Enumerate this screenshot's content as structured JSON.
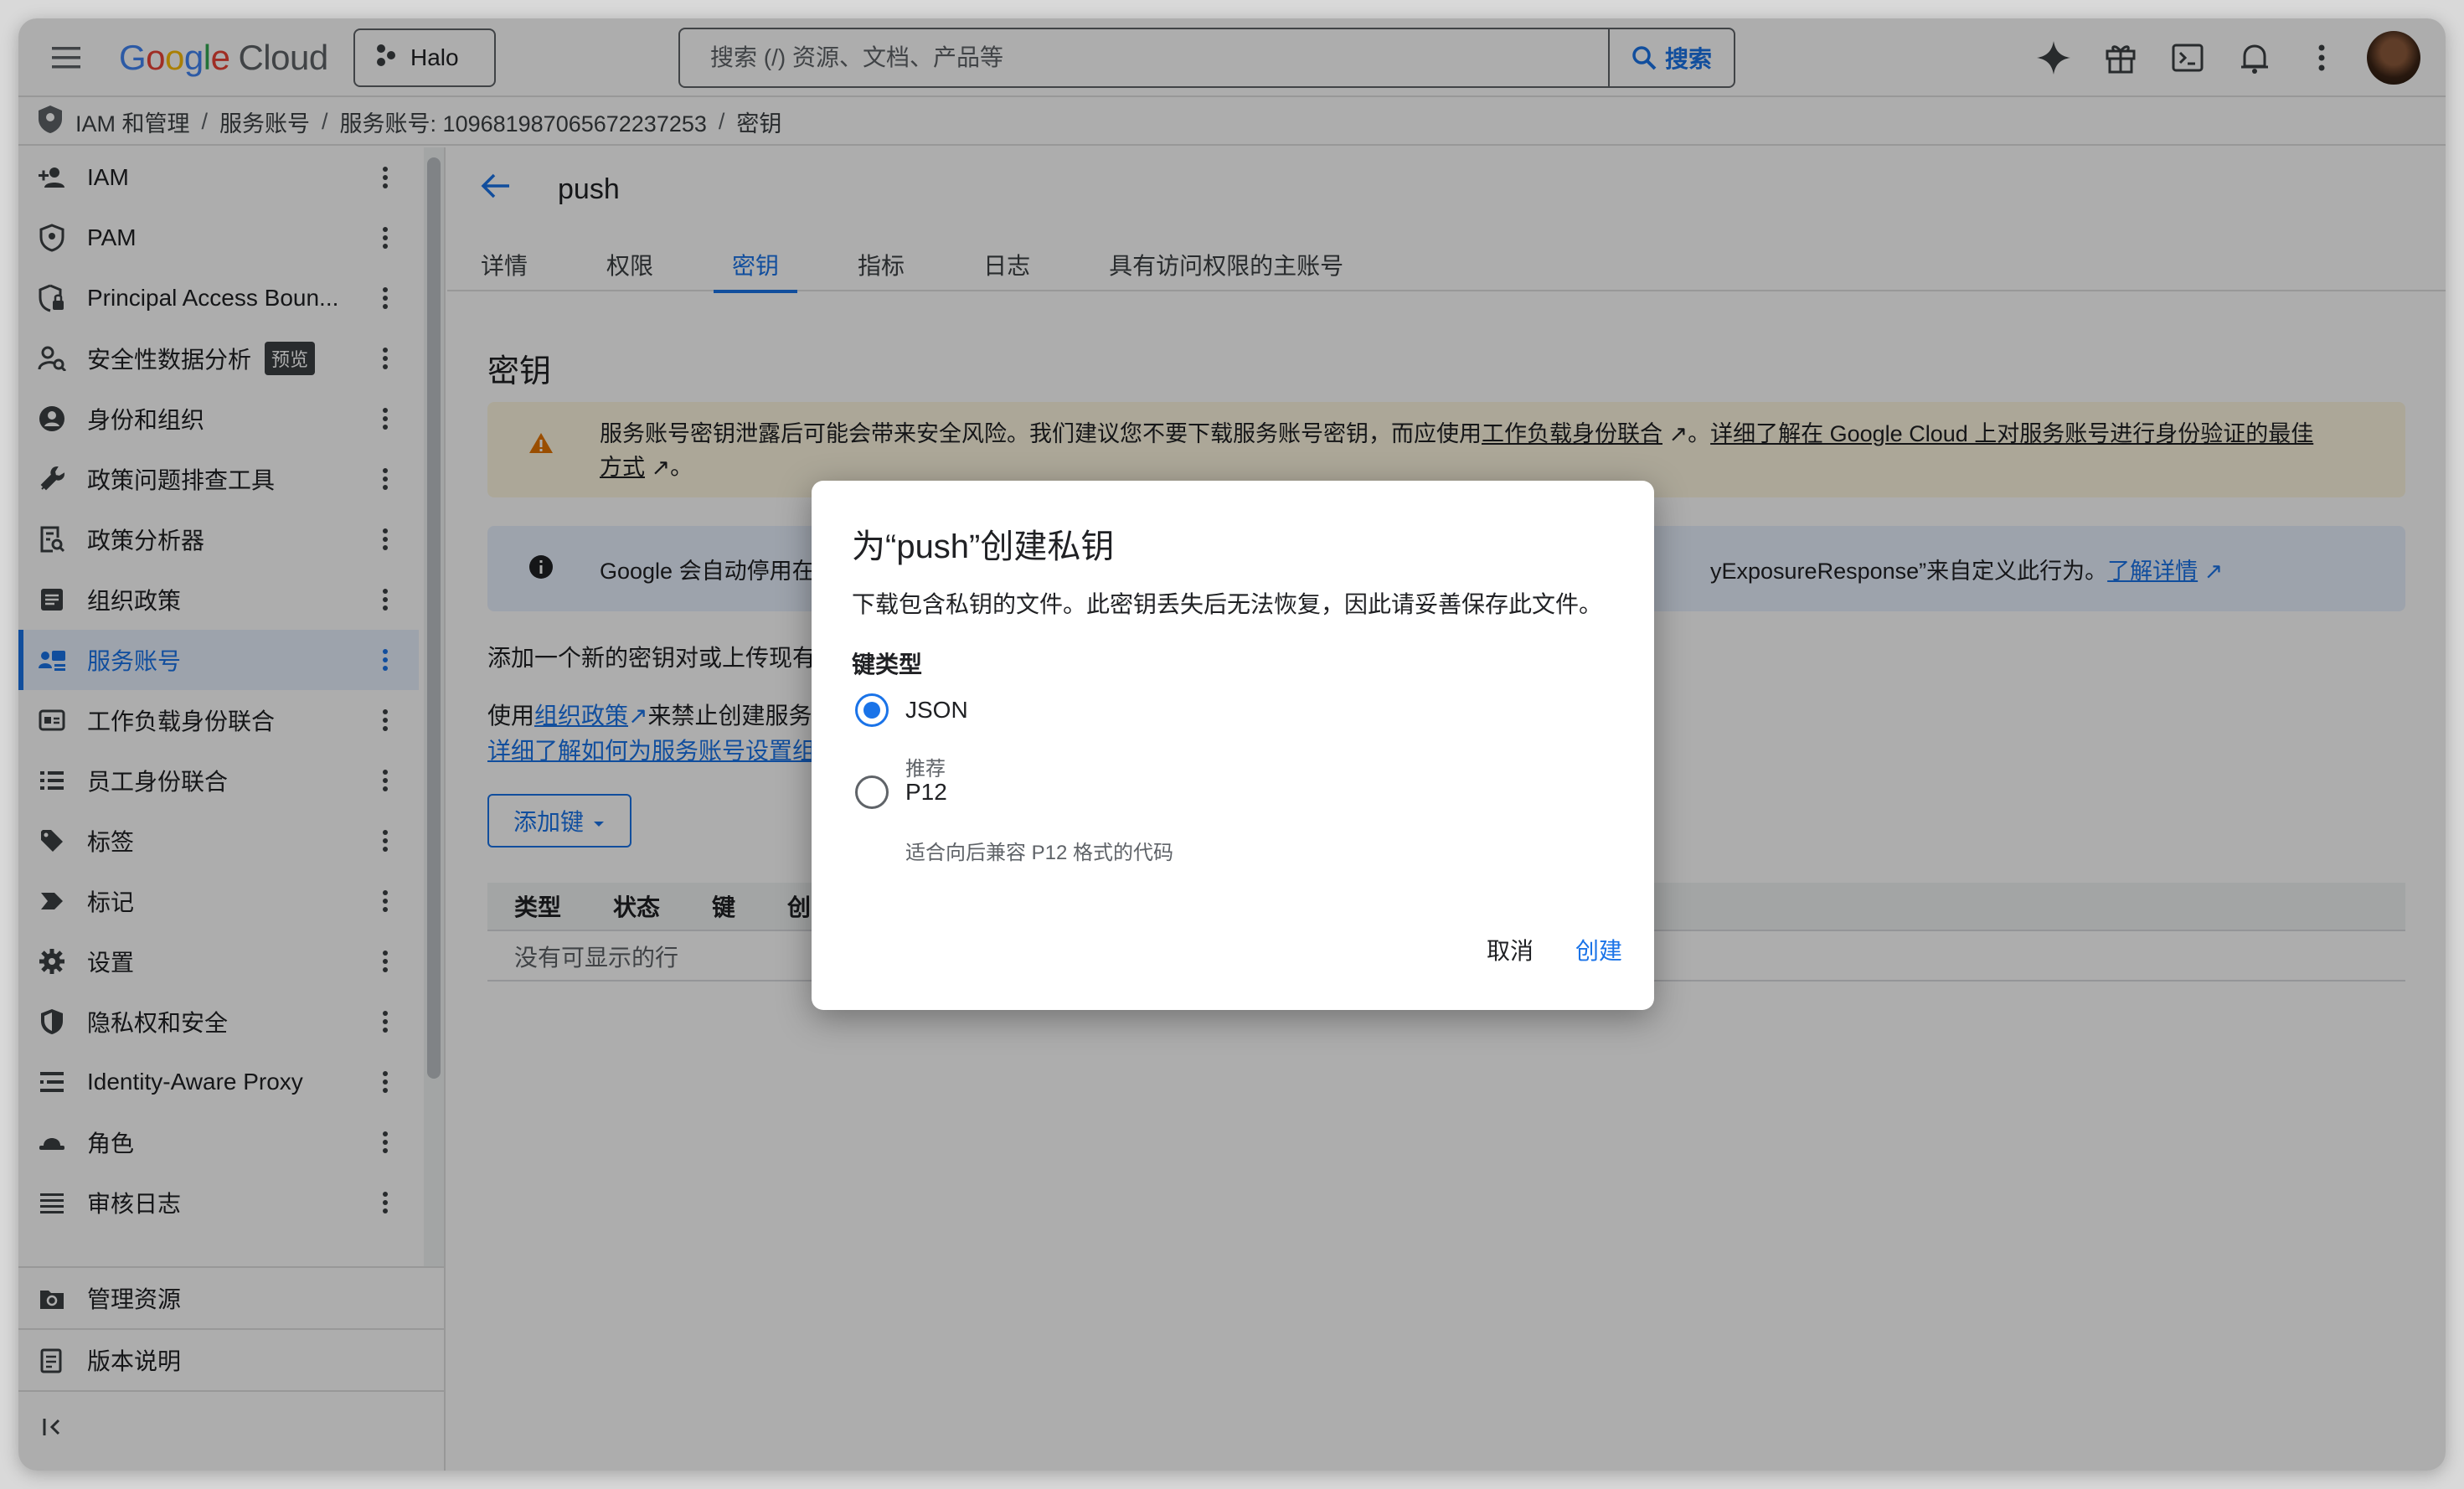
{
  "topbar": {
    "logo_parts": [
      "G",
      "o",
      "o",
      "g",
      "l",
      "e"
    ],
    "logo_cloud": "Cloud",
    "project_name": "Halo",
    "search_placeholder": "搜索 (/) 资源、文档、产品等",
    "search_button": "搜索"
  },
  "breadcrumb": {
    "items": [
      "IAM 和管理",
      "服务账号",
      "服务账号: 109681987065672237253",
      "密钥"
    ]
  },
  "sidebar": {
    "items": [
      {
        "label": "IAM",
        "icon": "person-add-icon"
      },
      {
        "label": "PAM",
        "icon": "shield-icon"
      },
      {
        "label": "Principal Access Boun...",
        "icon": "shield-lock-icon"
      },
      {
        "label": "安全性数据分析",
        "icon": "person-search-icon",
        "badge": "预览"
      },
      {
        "label": "身份和组织",
        "icon": "account-circle-icon"
      },
      {
        "label": "政策问题排查工具",
        "icon": "wrench-icon"
      },
      {
        "label": "政策分析器",
        "icon": "doc-search-icon"
      },
      {
        "label": "组织政策",
        "icon": "list-box-icon"
      },
      {
        "label": "服务账号",
        "icon": "service-account-icon"
      },
      {
        "label": "工作负载身份联合",
        "icon": "id-card-icon"
      },
      {
        "label": "员工身份联合",
        "icon": "list-icon"
      },
      {
        "label": "标签",
        "icon": "tag-icon"
      },
      {
        "label": "标记",
        "icon": "label-icon"
      },
      {
        "label": "设置",
        "icon": "gear-icon"
      },
      {
        "label": "隐私权和安全",
        "icon": "privacy-shield-icon"
      },
      {
        "label": "Identity-Aware Proxy",
        "icon": "proxy-icon"
      },
      {
        "label": "角色",
        "icon": "hat-icon"
      },
      {
        "label": "审核日志",
        "icon": "lines-icon"
      }
    ],
    "active_index": 8,
    "bottom": [
      {
        "label": "管理资源",
        "icon": "manage-resources-icon"
      },
      {
        "label": "版本说明",
        "icon": "release-notes-icon"
      }
    ],
    "collapse_icon": "collapse-left-icon"
  },
  "main": {
    "title": "push",
    "tabs": [
      "详情",
      "权限",
      "密钥",
      "指标",
      "日志",
      "具有访问权限的主账号"
    ],
    "active_tab": 2,
    "section_title": "密钥",
    "warning": {
      "text1": "服务账号密钥泄露后可能会带来安全风险。我们建议您不要下载服务账号密钥，而应使用",
      "link1": "工作负载身份联合",
      "text2": "。",
      "link2": "详细了解在 Google Cloud 上对服务账号进行身份验证的最佳",
      "link2b": "方式",
      "text3": "。"
    },
    "info": {
      "text_left": "Google 会自动停用在",
      "text_right": "yExposureResponse”来自定义此行为。",
      "link": "了解详情"
    },
    "desc1": "添加一个新的密钥对或上传现有",
    "desc2_prefix": "使用",
    "desc2_link": "组织政策",
    "desc2_suffix": "来禁止创建服务",
    "desc3_link": "详细了解如何为服务账号设置组",
    "add_key_button": "添加键",
    "table_headers": [
      "类型",
      "状态",
      "键",
      "创"
    ],
    "table_empty": "没有可显示的行"
  },
  "dialog": {
    "title": "为“push”创建私钥",
    "description": "下载包含私钥的文件。此密钥丢失后无法恢复，因此请妥善保存此文件。",
    "key_type_label": "键类型",
    "options": [
      {
        "label": "JSON",
        "sub": "推荐",
        "checked": true
      },
      {
        "label": "P12",
        "sub": "适合向后兼容 P12 格式的代码",
        "checked": false
      }
    ],
    "cancel": "取消",
    "create": "创建"
  },
  "colors": {
    "accent": "#1a73e8",
    "warning_bg": "#fef7e0",
    "warning_icon": "#e37400",
    "info_bg": "#e8f0fe"
  }
}
